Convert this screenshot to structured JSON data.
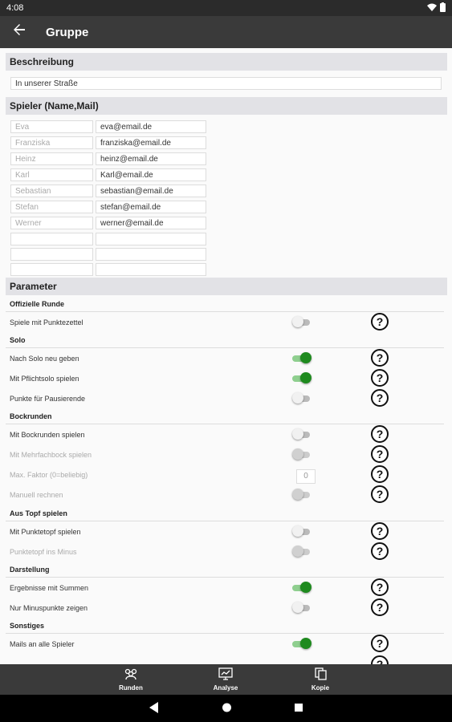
{
  "status": {
    "time": "4:08"
  },
  "appbar": {
    "title": "Gruppe"
  },
  "sections": {
    "beschreibung": "Beschreibung",
    "spieler": "Spieler (Name,Mail)",
    "parameter": "Parameter"
  },
  "description": {
    "value": "In unserer Straße"
  },
  "players": [
    {
      "name": "Eva",
      "mail": "eva@email.de"
    },
    {
      "name": "Franziska",
      "mail": "franziska@email.de"
    },
    {
      "name": "Heinz",
      "mail": "heinz@email.de"
    },
    {
      "name": "Karl",
      "mail": "Karl@email.de"
    },
    {
      "name": "Sebastian",
      "mail": "sebastian@email.de"
    },
    {
      "name": "Stefan",
      "mail": "stefan@email.de"
    },
    {
      "name": "Werner",
      "mail": "werner@email.de"
    },
    {
      "name": "",
      "mail": ""
    },
    {
      "name": "",
      "mail": ""
    },
    {
      "name": "",
      "mail": ""
    }
  ],
  "params": {
    "groups": {
      "offizielle": "Offizielle Runde",
      "solo": "Solo",
      "bock": "Bockrunden",
      "topf": "Aus Topf spielen",
      "darstellung": "Darstellung",
      "sonstiges": "Sonstiges"
    },
    "rows": {
      "punktezettel": "Spiele mit Punktezettel",
      "nachsolo": "Nach Solo neu geben",
      "pflichtsolo": "Mit Pflichtsolo spielen",
      "pausierende": "Punkte für Pausierende",
      "bockrunden": "Mit Bockrunden spielen",
      "mehrfachbock": "Mit Mehrfachbock spielen",
      "maxfaktor": "Max. Faktor (0=beliebig)",
      "manuell": "Manuell rechnen",
      "punktetopf": "Mit Punktetopf spielen",
      "topfminus": "Punktetopf ins Minus",
      "summen": "Ergebnisse mit Summen",
      "minuspunkte": "Nur Minuspunkte zeigen",
      "mails": "Mails an alle Spieler"
    },
    "maxfaktor_value": "0",
    "help_glyph": "?"
  },
  "nav": {
    "runden": "Runden",
    "analyse": "Analyse",
    "kopie": "Kopie"
  },
  "colors": {
    "accent": "#1e8a1e",
    "appbar": "#3a3a3a"
  }
}
